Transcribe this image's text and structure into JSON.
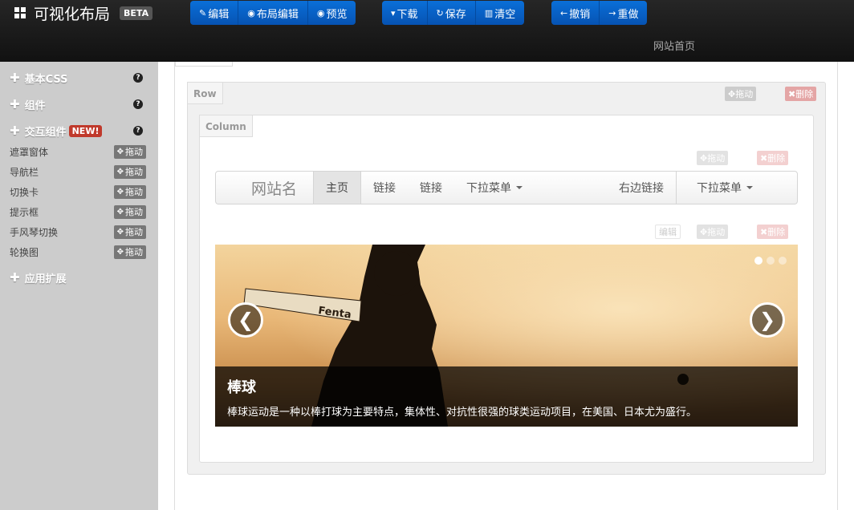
{
  "header": {
    "title": "可视化布局",
    "badge": "BETA",
    "toolbar": {
      "edit": "编辑",
      "layout_edit": "布局编辑",
      "preview": "预览",
      "download": "下载",
      "save": "保存",
      "clear": "清空",
      "undo": "撤销",
      "redo": "重做"
    },
    "home_link": "网站首页"
  },
  "sidebar": {
    "sections": {
      "basic_css": "基本CSS",
      "components": "组件",
      "interactive": "交互组件",
      "interactive_badge": "NEW!",
      "extensions": "应用扩展"
    },
    "help_glyph": "?",
    "drag_label": "拖动",
    "items": [
      {
        "label": "遮罩窗体"
      },
      {
        "label": "导航栏"
      },
      {
        "label": "切换卡"
      },
      {
        "label": "提示框"
      },
      {
        "label": "手风琴切换"
      },
      {
        "label": "轮换图"
      }
    ]
  },
  "canvas": {
    "row_tag": "Row",
    "column_tag": "Column",
    "drag_label": "拖动",
    "delete_label": "删除",
    "edit_label": "编辑",
    "navbar": {
      "brand": "网站名",
      "items": [
        "主页",
        "链接",
        "链接"
      ],
      "dropdown_left": "下拉菜单",
      "right_link": "右边链接",
      "dropdown_right": "下拉菜单"
    },
    "carousel": {
      "prev": "❮",
      "next": "❯",
      "active_slide": 1,
      "slide_count": 3,
      "caption_title": "棒球",
      "caption_text": "棒球运动是一种以棒打球为主要特点，集体性、对抗性很强的球类运动项目，在美国、日本尤为盛行。",
      "bat_text": "Fenta"
    }
  },
  "colors": {
    "toolbar_blue": "#0a6fd8",
    "sidebar_bg": "#cccccc",
    "new_badge": "#c0392b"
  }
}
